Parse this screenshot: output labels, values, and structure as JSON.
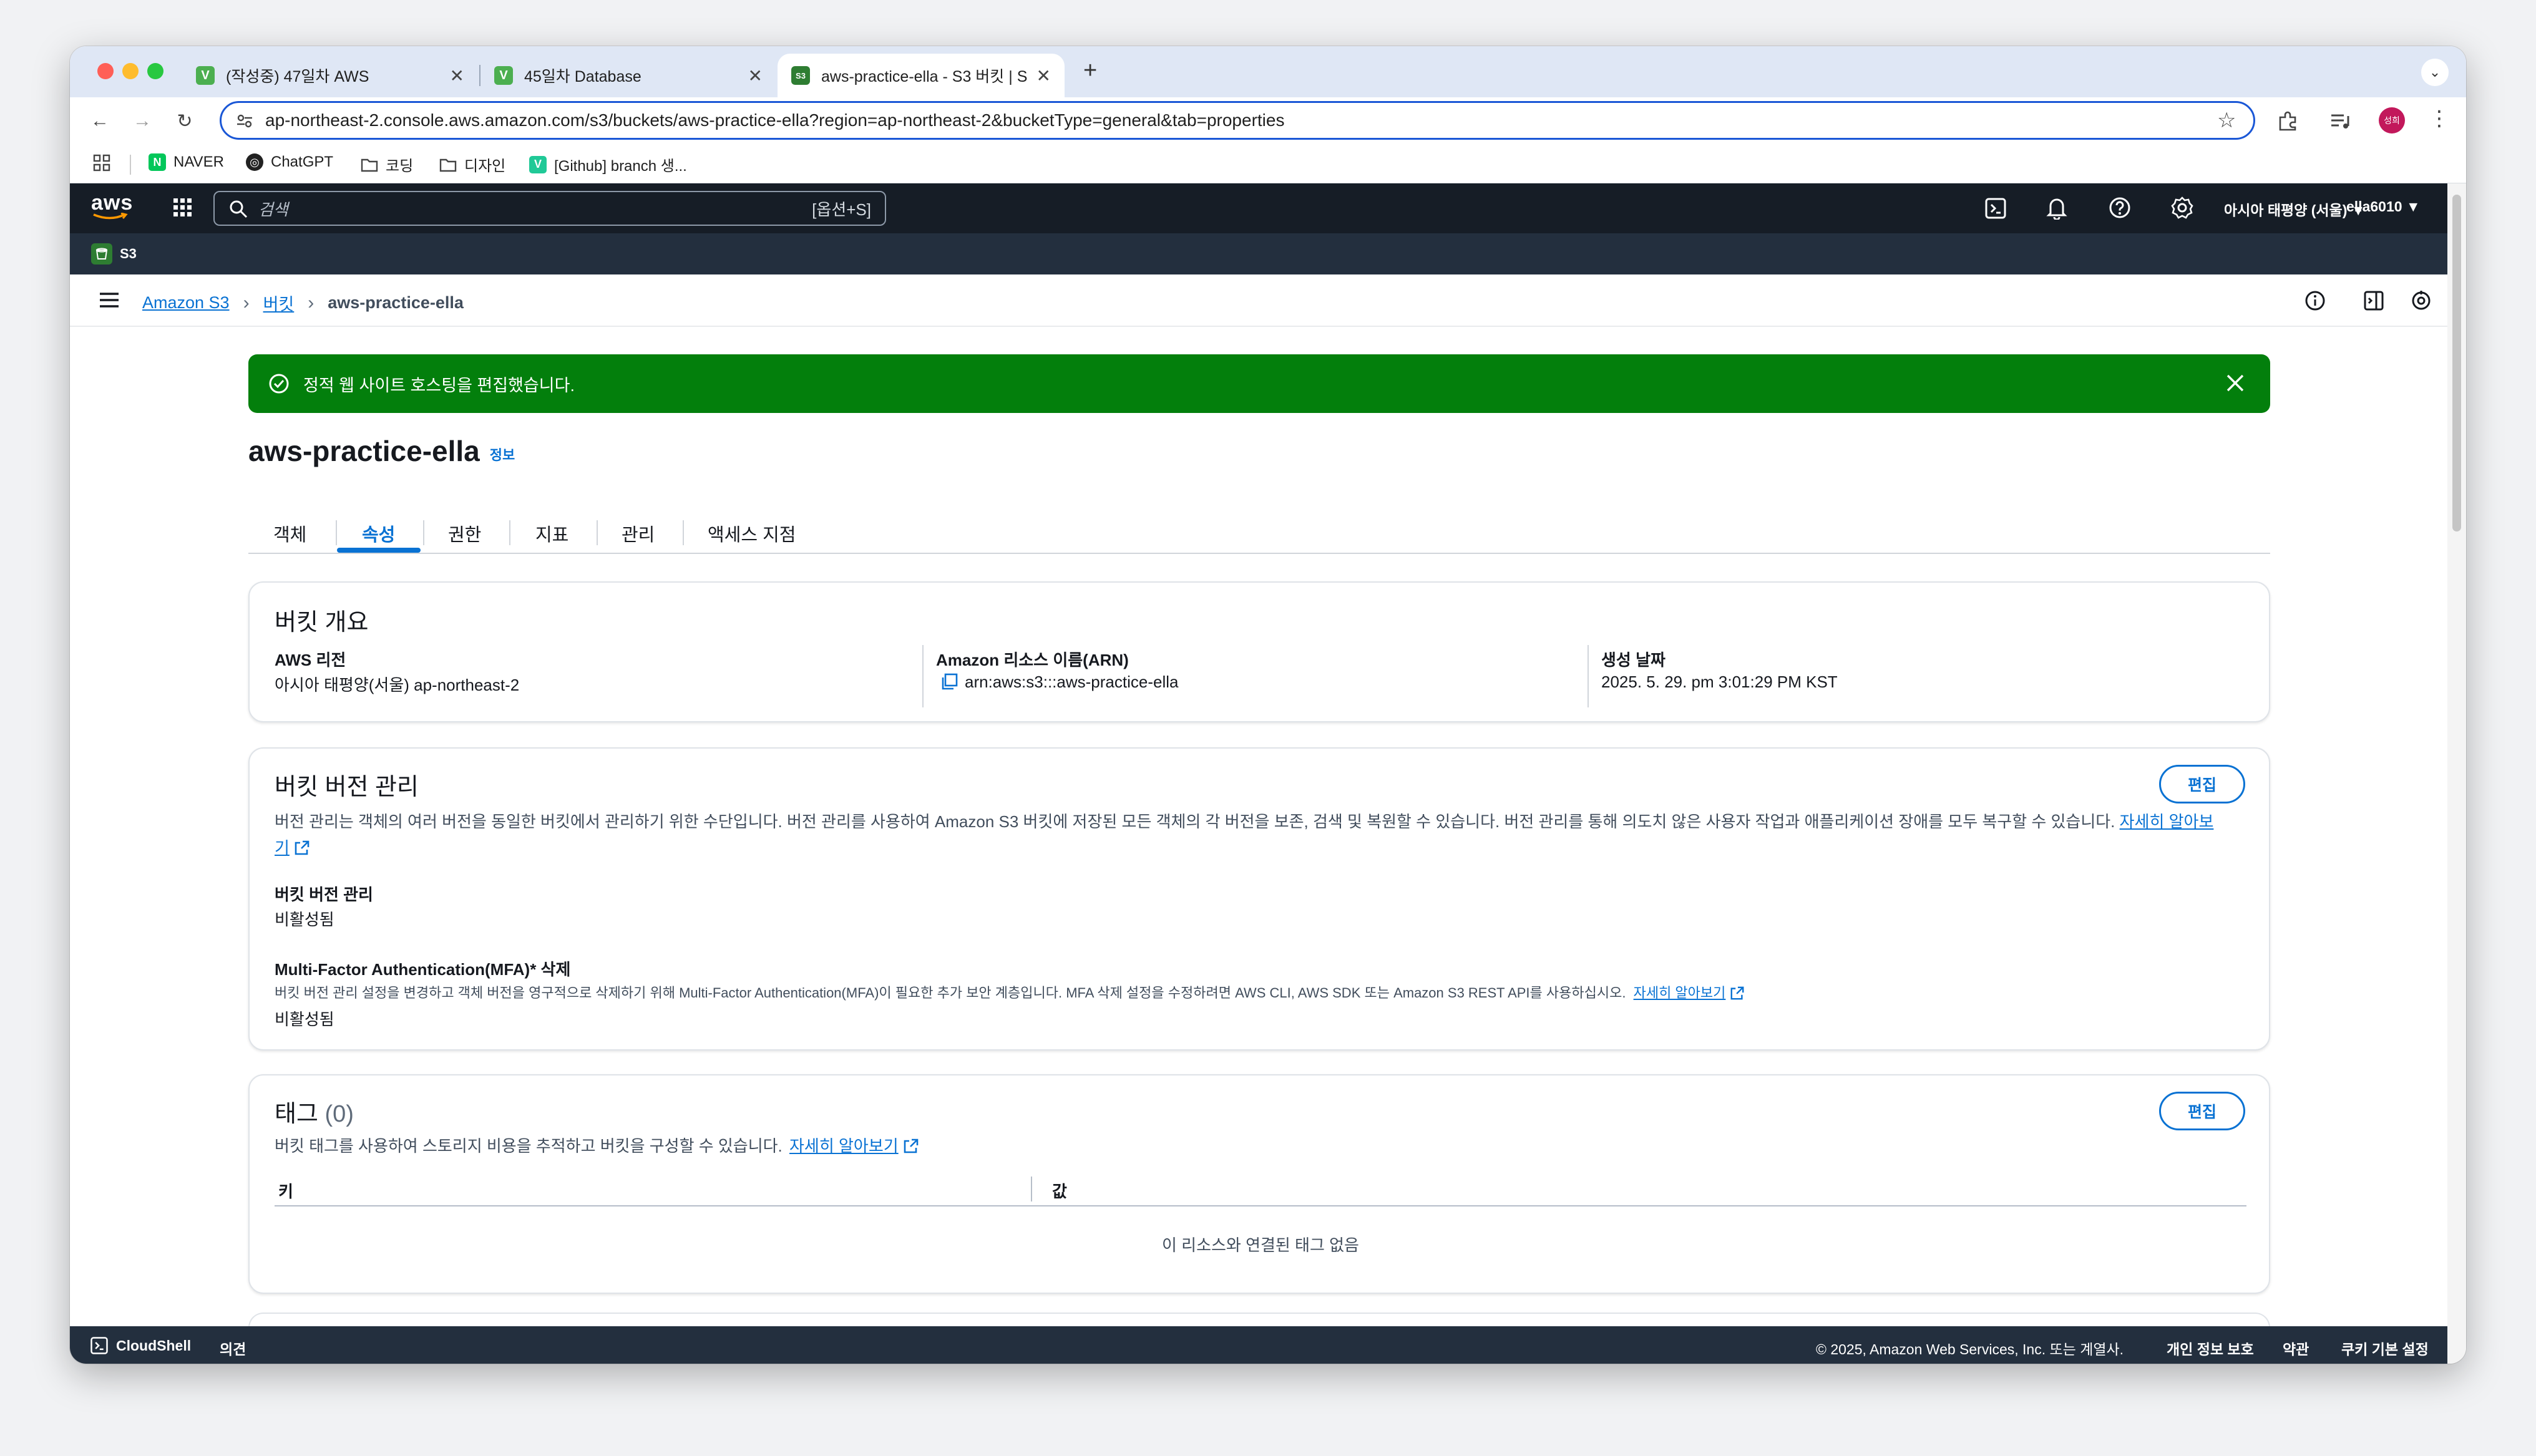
{
  "browser": {
    "tabs": [
      {
        "title": "(작성중) 47일차 AWS",
        "favicon": "V",
        "active": false
      },
      {
        "title": "45일차 Database",
        "favicon": "V",
        "active": false
      },
      {
        "title": "aws-practice-ella - S3 버킷 | S",
        "favicon": "S3",
        "active": true
      }
    ],
    "url": "ap-northeast-2.console.aws.amazon.com/s3/buckets/aws-practice-ella?region=ap-northeast-2&bucketType=general&tab=properties",
    "bookmarks": [
      {
        "label": "NAVER",
        "icon": "naver-icon"
      },
      {
        "label": "ChatGPT",
        "icon": "chatgpt-icon"
      },
      {
        "label": "코딩",
        "icon": "folder-icon"
      },
      {
        "label": "디자인",
        "icon": "folder-icon"
      },
      {
        "label": "[Github] branch 생...",
        "icon": "velog-icon"
      }
    ],
    "profile_initial": "성희"
  },
  "aws_header": {
    "logo": "aws",
    "search_placeholder": "검색",
    "search_shortcut": "[옵션+S]",
    "region": "아시아 태평양 (서울) ▼",
    "account": "ella6010 ▼",
    "service": "S3"
  },
  "breadcrumb": {
    "items": [
      "Amazon S3",
      "버킷"
    ],
    "current": "aws-practice-ella"
  },
  "flash": {
    "message": "정적 웹 사이트 호스팅을 편집했습니다."
  },
  "bucket": {
    "name": "aws-practice-ella",
    "info_link": "정보"
  },
  "tabs": [
    {
      "label": "객체",
      "active": false
    },
    {
      "label": "속성",
      "active": true
    },
    {
      "label": "권한",
      "active": false
    },
    {
      "label": "지표",
      "active": false
    },
    {
      "label": "관리",
      "active": false
    },
    {
      "label": "액세스 지점",
      "active": false
    }
  ],
  "overview": {
    "title": "버킷 개요",
    "region_label": "AWS 리전",
    "region_value": "아시아 태평양(서울) ap-northeast-2",
    "arn_label": "Amazon 리소스 이름(ARN)",
    "arn_value": "arn:aws:s3:::aws-practice-ella",
    "created_label": "생성 날짜",
    "created_value": "2025. 5. 29. pm 3:01:29 PM KST"
  },
  "versioning": {
    "title": "버킷 버전 관리",
    "edit_label": "편집",
    "description": "버전 관리는 객체의 여러 버전을 동일한 버킷에서 관리하기 위한 수단입니다. 버전 관리를 사용하여 Amazon S3 버킷에 저장된 모든 객체의 각 버전을 보존, 검색 및 복원할 수 있습니다. 버전 관리를 통해 의도치 않은 사용자 작업과 애플리케이션 장애를 모두 복구할 수 있습니다.",
    "learn_more_1": "자세히 알아보",
    "learn_more_2": "기",
    "status_label": "버킷 버전 관리",
    "status_value": "비활성됨",
    "mfa_label": "Multi-Factor Authentication(MFA)* 삭제",
    "mfa_description": "버킷 버전 관리 설정을 변경하고 객체 버전을 영구적으로 삭제하기 위해 Multi-Factor Authentication(MFA)이 필요한 추가 보안 계층입니다. MFA 삭제 설정을 수정하려면 AWS CLI, AWS SDK 또는 Amazon S3 REST API를 사용하십시오.",
    "mfa_learn_more": "자세히 알아보기",
    "mfa_value": "비활성됨"
  },
  "tags": {
    "title": "태그",
    "count": "(0)",
    "edit_label": "편집",
    "description": "버킷 태그를 사용하여 스토리지 비용을 추적하고 버킷을 구성할 수 있습니다.",
    "learn_more": "자세히 알아보기",
    "col_key": "키",
    "col_value": "값",
    "empty": "이 리소스와 연결된 태그 없음"
  },
  "footer": {
    "cloudshell": "CloudShell",
    "feedback": "의견",
    "copyright": "© 2025, Amazon Web Services, Inc. 또는 계열사.",
    "privacy": "개인 정보 보호",
    "terms": "약관",
    "cookies": "쿠키 기본 설정"
  },
  "colors": {
    "aws_header": "#161d26",
    "services_bar": "#232f3e",
    "success": "#037f0c",
    "link": "#0972d3",
    "tabstrip": "#dfe7f5"
  }
}
